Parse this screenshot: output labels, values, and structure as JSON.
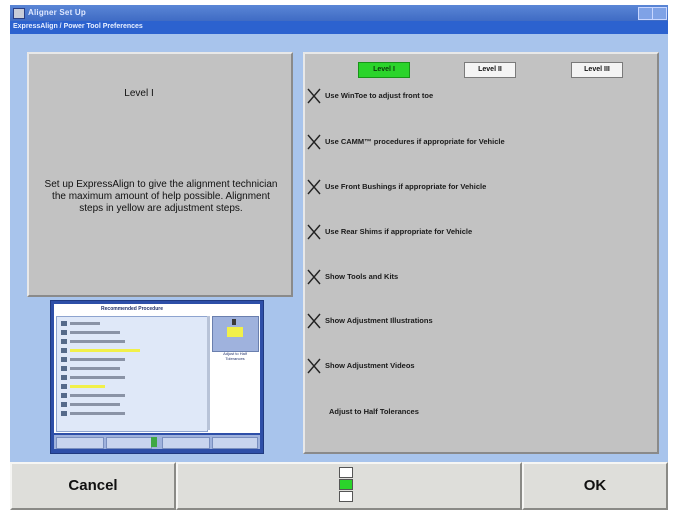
{
  "window": {
    "title": "Aligner Set Up",
    "subtitle": "ExpressAlign / Power Tool Preferences"
  },
  "left_panel": {
    "level_title": "Level I",
    "description": "Set up ExpressAlign to give the alignment technician the maximum amount of help possible.  Alignment steps in yellow are adjustment steps."
  },
  "preview": {
    "title": "Recommended Procedure",
    "side_caption": "Adjust to Half Tolerances"
  },
  "levels": [
    {
      "label": "Level I",
      "active": true
    },
    {
      "label": "Level II",
      "active": false
    },
    {
      "label": "Level III",
      "active": false
    }
  ],
  "options": [
    {
      "label": "Use WinToe to adjust front toe",
      "checked": true
    },
    {
      "label": "Use CAMM™ procedures if appropriate for Vehicle",
      "checked": true
    },
    {
      "label": "Use Front Bushings if appropriate for Vehicle",
      "checked": true
    },
    {
      "label": "Use Rear Shims if appropriate for Vehicle",
      "checked": true
    },
    {
      "label": "Show Tools and Kits",
      "checked": true
    },
    {
      "label": "Show Adjustment Illustrations",
      "checked": true
    },
    {
      "label": "Show Adjustment Videos",
      "checked": true
    },
    {
      "label": "Adjust to Half Tolerances",
      "checked": false
    }
  ],
  "buttons": {
    "cancel": "Cancel",
    "ok": "OK"
  },
  "pager": {
    "pages": 3,
    "current": 2
  },
  "colors": {
    "title_bar": "#3f6bc4",
    "client_bg": "#a8c4ec",
    "panel_bg": "#c2c2c2",
    "active_level": "#2bd42b",
    "highlight_yellow": "#f1f04a"
  }
}
